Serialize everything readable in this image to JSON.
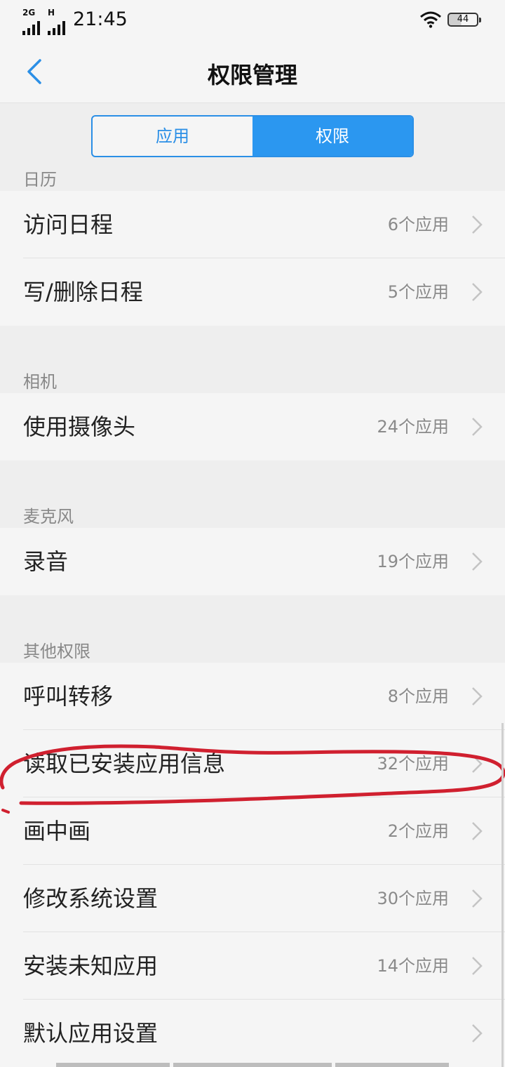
{
  "status_bar": {
    "network_1": "2G",
    "network_2": "H",
    "time": "21:45",
    "battery": "44"
  },
  "nav": {
    "title": "权限管理",
    "back_icon": "chevron-left-icon"
  },
  "tabs": [
    {
      "label": "应用",
      "active": false
    },
    {
      "label": "权限",
      "active": true
    }
  ],
  "sections": [
    {
      "header": "日历",
      "items": [
        {
          "label": "访问日程",
          "count": "6个应用"
        },
        {
          "label": "写/删除日程",
          "count": "5个应用"
        }
      ]
    },
    {
      "header": "相机",
      "items": [
        {
          "label": "使用摄像头",
          "count": "24个应用"
        }
      ]
    },
    {
      "header": "麦克风",
      "items": [
        {
          "label": "录音",
          "count": "19个应用"
        }
      ]
    },
    {
      "header": "其他权限",
      "items": [
        {
          "label": "呼叫转移",
          "count": "8个应用"
        },
        {
          "label": "读取已安装应用信息",
          "count": "32个应用"
        },
        {
          "label": "画中画",
          "count": "2个应用"
        },
        {
          "label": "修改系统设置",
          "count": "30个应用"
        },
        {
          "label": "安装未知应用",
          "count": "14个应用"
        },
        {
          "label": "默认应用设置",
          "count": ""
        }
      ]
    }
  ],
  "colors": {
    "accent": "#2b97f0",
    "annotation": "#d0202f"
  }
}
